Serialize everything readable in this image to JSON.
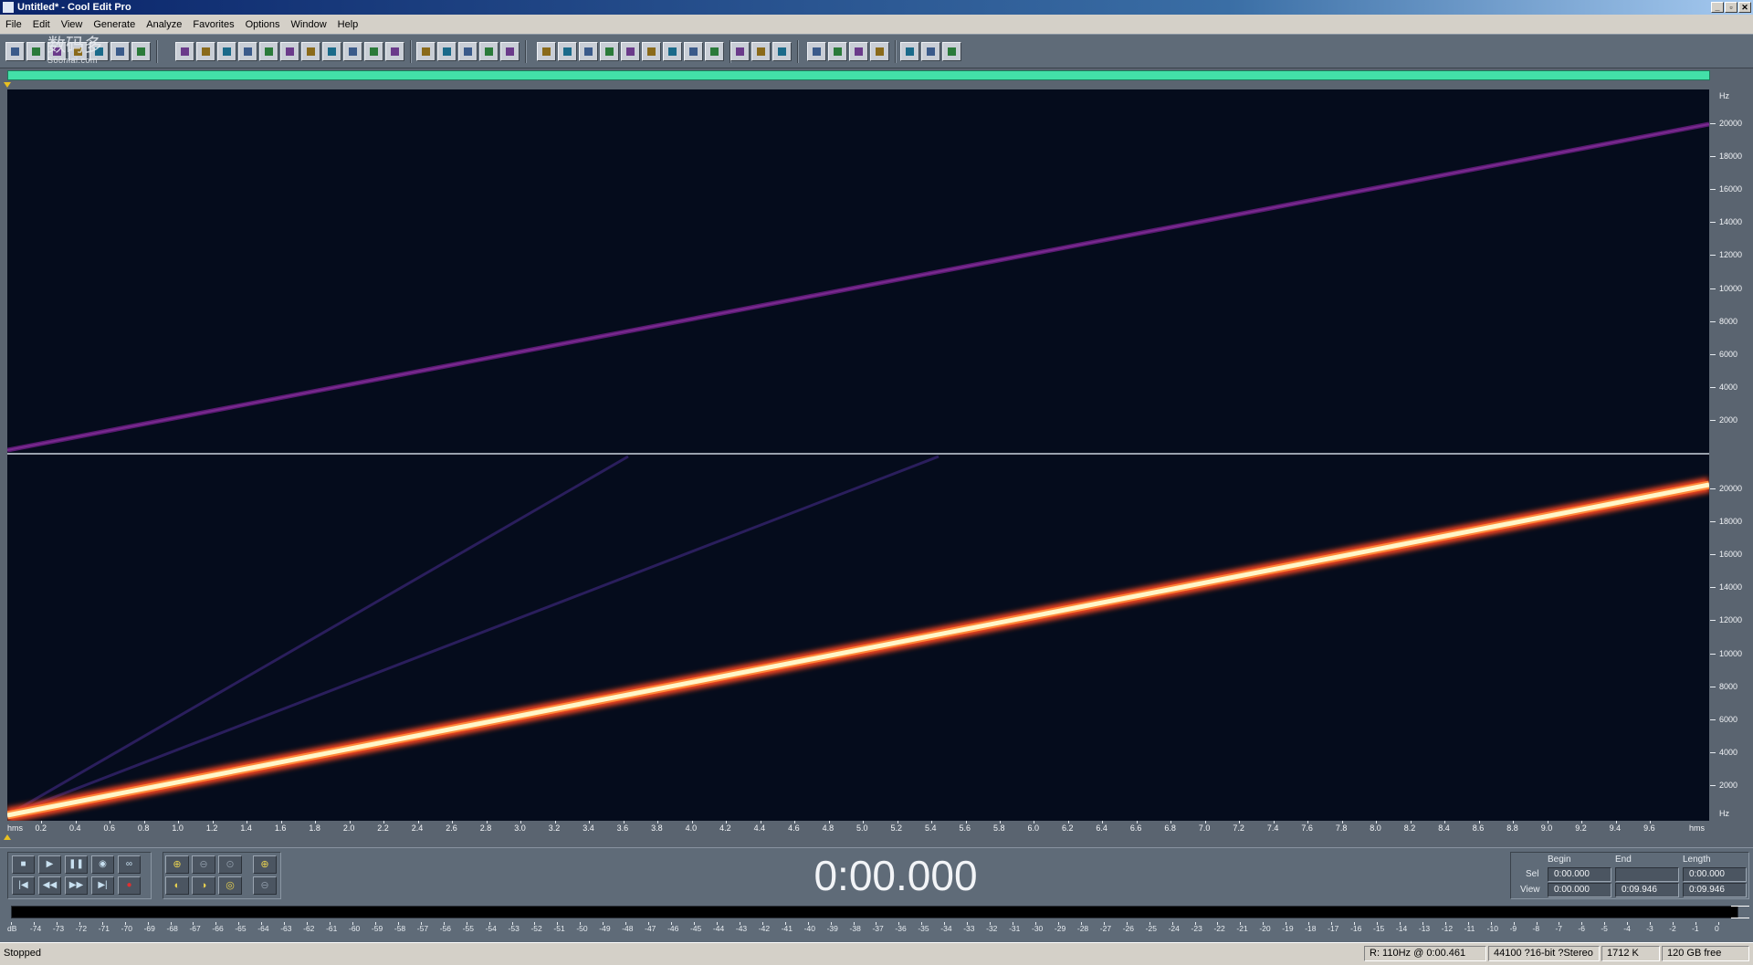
{
  "window": {
    "title": "Untitled* - Cool Edit Pro",
    "buttons": [
      "_",
      "▫",
      "✕"
    ]
  },
  "menu": [
    "File",
    "Edit",
    "View",
    "Generate",
    "Analyze",
    "Favorites",
    "Options",
    "Window",
    "Help"
  ],
  "watermark": {
    "main": "数码多",
    "sub": "Soomal.com"
  },
  "spectral": {
    "channels": [
      "left",
      "right"
    ],
    "hz_label": "Hz",
    "hz_ticks": [
      "20000",
      "18000",
      "16000",
      "14000",
      "12000",
      "10000",
      "8000",
      "6000",
      "4000",
      "2000"
    ],
    "time_ticks": [
      "0.2",
      "0.4",
      "0.6",
      "0.8",
      "1.0",
      "1.2",
      "1.4",
      "1.6",
      "1.8",
      "2.0",
      "2.2",
      "2.4",
      "2.6",
      "2.8",
      "3.0",
      "3.2",
      "3.4",
      "3.6",
      "3.8",
      "4.0",
      "4.2",
      "4.4",
      "4.6",
      "4.8",
      "5.0",
      "5.2",
      "5.4",
      "5.6",
      "5.8",
      "6.0",
      "6.2",
      "6.4",
      "6.6",
      "6.8",
      "7.0",
      "7.2",
      "7.4",
      "7.6",
      "7.8",
      "8.0",
      "8.2",
      "8.4",
      "8.6",
      "8.8",
      "9.0",
      "9.2",
      "9.4",
      "9.6"
    ],
    "time_unit": "hms",
    "colors": {
      "background": "#050c1c",
      "left_sweep": "#5a1a72",
      "right_sweep": "#fff6c8",
      "right_glow": "#ff5a2a"
    }
  },
  "transport": {
    "time": "0:00.000",
    "buttons": [
      "stop",
      "play",
      "pause",
      "play-to-end",
      "loop",
      "go-to-start",
      "rewind",
      "fast-forward",
      "go-to-end",
      "record"
    ]
  },
  "selection": {
    "headers": [
      "Begin",
      "End",
      "Length"
    ],
    "rows": [
      {
        "label": "Sel",
        "begin": "0:00.000",
        "end": "",
        "length": "0:00.000"
      },
      {
        "label": "View",
        "begin": "0:00.000",
        "end": "0:09.946",
        "length": "0:09.946"
      }
    ]
  },
  "meter": {
    "labels": [
      "dB",
      "-74",
      "-73",
      "-72",
      "-71",
      "-70",
      "-69",
      "-68",
      "-67",
      "-66",
      "-65",
      "-64",
      "-63",
      "-62",
      "-61",
      "-60",
      "-59",
      "-58",
      "-57",
      "-56",
      "-55",
      "-54",
      "-53",
      "-52",
      "-51",
      "-50",
      "-49",
      "-48",
      "-47",
      "-46",
      "-45",
      "-44",
      "-43",
      "-42",
      "-41",
      "-40",
      "-39",
      "-38",
      "-37",
      "-36",
      "-35",
      "-34",
      "-33",
      "-32",
      "-31",
      "-30",
      "-29",
      "-28",
      "-27",
      "-26",
      "-25",
      "-24",
      "-23",
      "-22",
      "-21",
      "-20",
      "-19",
      "-18",
      "-17",
      "-16",
      "-15",
      "-14",
      "-13",
      "-12",
      "-11",
      "-10",
      "-9",
      "-8",
      "-7",
      "-6",
      "-5",
      "-4",
      "-3",
      "-2",
      "-1",
      "0"
    ]
  },
  "status": {
    "state": "Stopped",
    "cursor": "R: 110Hz @  0:00.461",
    "format": "44100 ?16-bit ?Stereo",
    "size": "1712 K",
    "free": "120 GB free"
  }
}
